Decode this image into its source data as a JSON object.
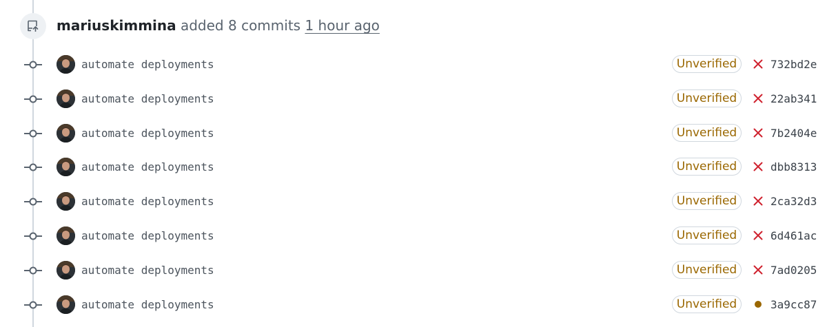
{
  "event": {
    "actor": "mariuskimmina",
    "action": "added 8 commits",
    "time": "1 hour ago",
    "icon": "repo-push-icon"
  },
  "badge_label": "Unverified",
  "commits": [
    {
      "message": "automate deployments",
      "sha": "732bd2e",
      "status": "failure"
    },
    {
      "message": "automate deployments",
      "sha": "22ab341",
      "status": "failure"
    },
    {
      "message": "automate deployments",
      "sha": "7b2404e",
      "status": "failure"
    },
    {
      "message": "automate deployments",
      "sha": "dbb8313",
      "status": "failure"
    },
    {
      "message": "automate deployments",
      "sha": "2ca32d3",
      "status": "failure"
    },
    {
      "message": "automate deployments",
      "sha": "6d461ac",
      "status": "failure"
    },
    {
      "message": "automate deployments",
      "sha": "7ad0205",
      "status": "failure"
    },
    {
      "message": "automate deployments",
      "sha": "3a9cc87",
      "status": "pending"
    }
  ],
  "colors": {
    "failure": "#cf222e",
    "pending": "#9a6700",
    "unverified_text": "#9a6700",
    "timeline": "#d0d7de"
  }
}
